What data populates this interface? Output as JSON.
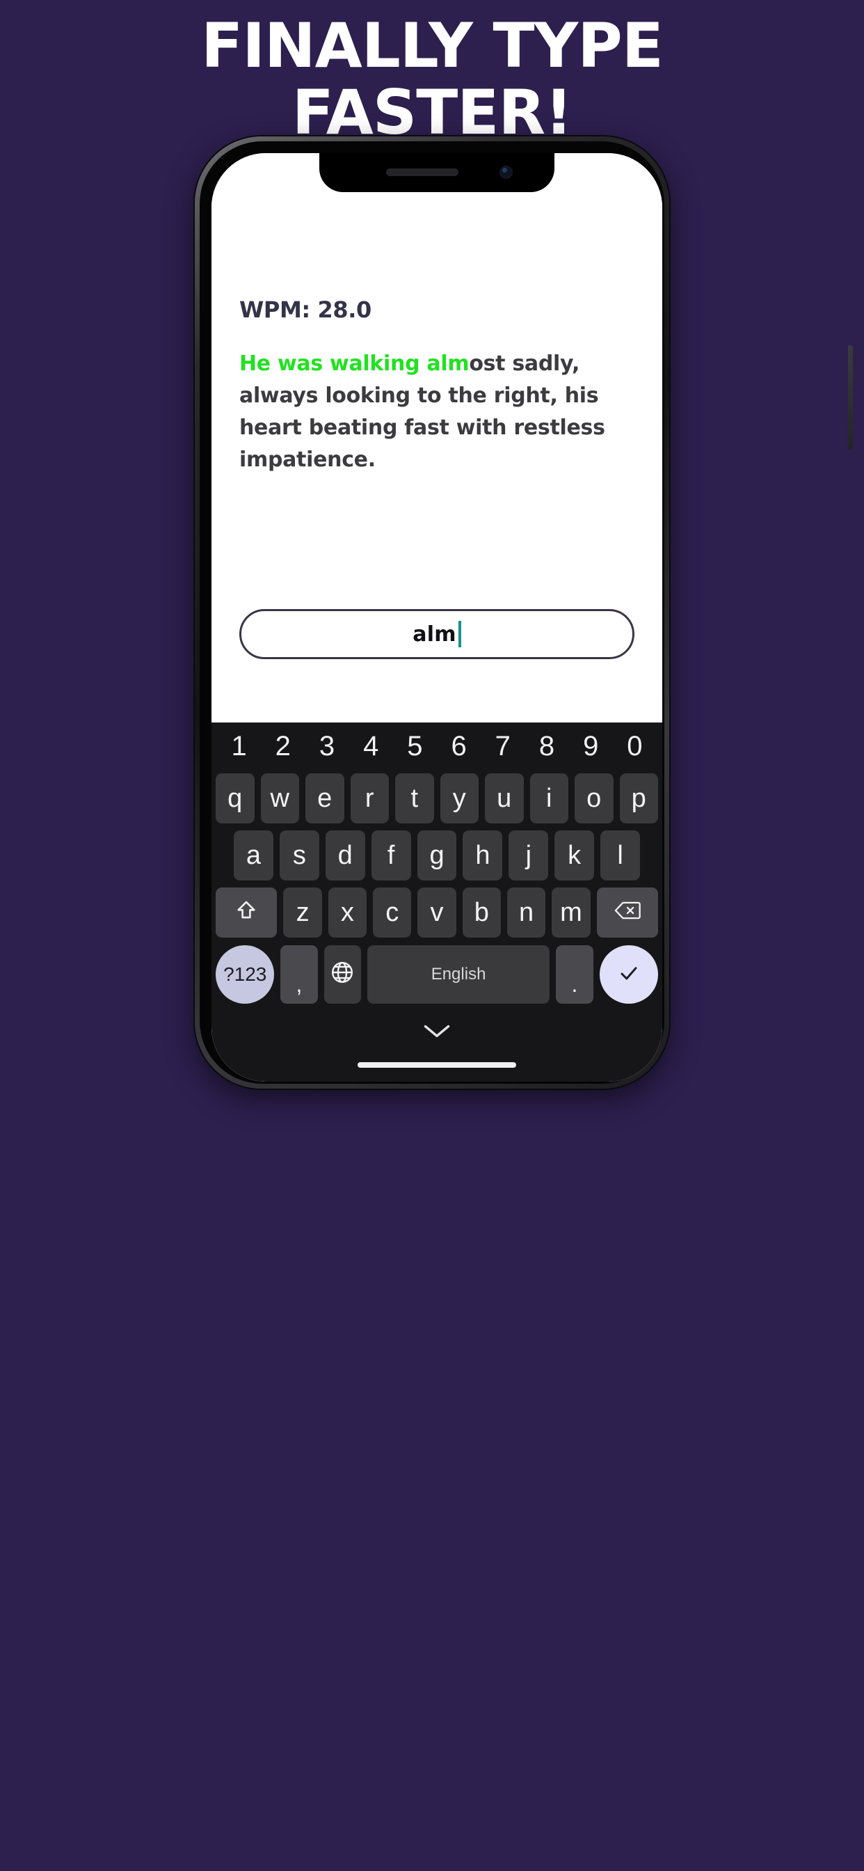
{
  "theme": {
    "background": "#2d1f4e",
    "headline_color": "#ffffff",
    "typed_green": "#22e122",
    "untyped_gray": "#3c3c3e",
    "wpm_color": "#353349",
    "caret_color": "#17928c",
    "keyboard_bg": "#161618",
    "key_bg": "#3a3a3d",
    "accent_key_bg": "#e0e0fb",
    "symbol_key_bg": "#c6c7e0"
  },
  "headline": {
    "line1": "FINALLY TYPE",
    "line2": "FASTER!"
  },
  "app": {
    "wpm_label": "WPM: 28.0",
    "passage": {
      "typed": "He was walking alm",
      "remaining": "ost sadly, always looking to the right, his heart beating fast with restless impatience.",
      "full": "He was walking almost sadly, always looking to the right, his heart beating fast with restless impatience."
    },
    "input": {
      "value": "alm",
      "placeholder": ""
    }
  },
  "keyboard": {
    "numbers": [
      "1",
      "2",
      "3",
      "4",
      "5",
      "6",
      "7",
      "8",
      "9",
      "0"
    ],
    "row1": [
      "q",
      "w",
      "e",
      "r",
      "t",
      "y",
      "u",
      "i",
      "o",
      "p"
    ],
    "row2": [
      "a",
      "s",
      "d",
      "f",
      "g",
      "h",
      "j",
      "k",
      "l"
    ],
    "row3": [
      "z",
      "x",
      "c",
      "v",
      "b",
      "n",
      "m"
    ],
    "shift_icon": "shift-up-arrow-icon",
    "backspace_icon": "backspace-delete-icon",
    "symbols_key": "?123",
    "comma_key": ",",
    "globe_icon": "globe-language-icon",
    "space_label": "English",
    "period_key": ".",
    "enter_icon": "checkmark-icon",
    "hide_keyboard_icon": "chevron-down-icon"
  }
}
